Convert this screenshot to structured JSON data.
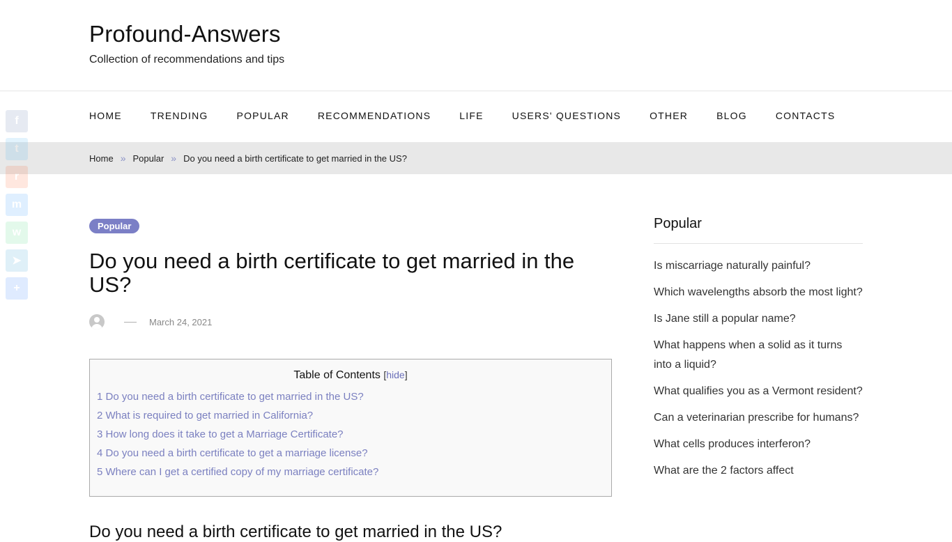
{
  "header": {
    "site_title": "Profound-Answers",
    "site_description": "Collection of recommendations and tips"
  },
  "nav": [
    "HOME",
    "TRENDING",
    "POPULAR",
    "RECOMMENDATIONS",
    "LIFE",
    "USERS' QUESTIONS",
    "OTHER",
    "BLOG",
    "CONTACTS"
  ],
  "breadcrumb": {
    "home": "Home",
    "category": "Popular",
    "current": "Do you need a birth certificate to get married in the US?",
    "separator": "»"
  },
  "share_icons": [
    {
      "icon": "facebook-icon",
      "color": "#3b5998",
      "glyph": "f"
    },
    {
      "icon": "twitter-icon",
      "color": "#1da1f2",
      "glyph": "t"
    },
    {
      "icon": "reddit-icon",
      "color": "#ff4500",
      "glyph": "r"
    },
    {
      "icon": "messenger-icon",
      "color": "#0084ff",
      "glyph": "m"
    },
    {
      "icon": "whatsapp-icon",
      "color": "#25d366",
      "glyph": "w"
    },
    {
      "icon": "telegram-icon",
      "color": "#0088cc",
      "glyph": "➤"
    },
    {
      "icon": "share-plus-icon",
      "color": "#0166ff",
      "glyph": "+"
    }
  ],
  "post": {
    "category_badge": "Popular",
    "title": "Do you need a birth certificate to get married in the US?",
    "date": "March 24, 2021",
    "first_heading": "Do you need a birth certificate to get married in the US?"
  },
  "toc": {
    "title": "Table of Contents",
    "hide_label": "hide",
    "items": [
      "1 Do you need a birth certificate to get married in the US?",
      "2 What is required to get married in California?",
      "3 How long does it take to get a Marriage Certificate?",
      "4 Do you need a birth certificate to get a marriage license?",
      "5 Where can I get a certified copy of my marriage certificate?"
    ]
  },
  "sidebar": {
    "title": "Popular",
    "items": [
      "Is miscarriage naturally painful?",
      "Which wavelengths absorb the most light?",
      "Is Jane still a popular name?",
      "What happens when a solid as it turns into a liquid?",
      "What qualifies you as a Vermont resident?",
      "Can a veterinarian prescribe for humans?",
      "What cells produces interferon?",
      "What are the 2 factors affect"
    ]
  },
  "colors": {
    "accent": "#7b7fc6",
    "link": "#7b80c0",
    "breadcrumb_bg": "#e8e8e8"
  }
}
